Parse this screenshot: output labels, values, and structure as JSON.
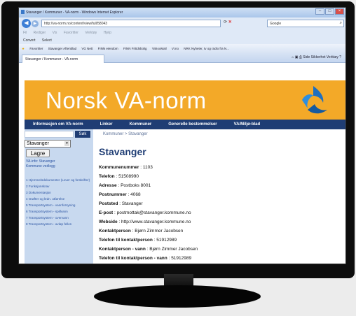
{
  "browser": {
    "window_title": "Stavanger / Kommuner - VA-norm - Windows Internet Explorer",
    "url": "http://va-norm.no/content/view/full/58043",
    "search_text": "Google",
    "menu_items": [
      "Fil",
      "Rediger",
      "Vis",
      "Favoritter",
      "Verktøy",
      "Hjelp"
    ],
    "convert_label": "Convert",
    "select_label": "Select",
    "favorites_label": "Favoritter",
    "favorites": [
      "Stavanger Aftenblad",
      "VG Nett",
      "FINN eiendom",
      "FINN Fritidsbolig",
      "YahooMail",
      "Vi.no",
      "NRK Nyheter, tv og radio fra N..."
    ],
    "tab_title": "Stavanger / Kommuner - VA-norm",
    "command_bar": [
      "Side",
      "Sikkerhet",
      "Verktøy"
    ]
  },
  "site": {
    "banner_title": "Norsk VA-norm",
    "nav": [
      "Informasjon om VA-norm",
      "Linker",
      "Kommuner",
      "Generelle bestemmelser",
      "VA/Miljø-blad"
    ],
    "search_button": "Søk",
    "municipality_select": "Stavanger",
    "save_button": "Lagre",
    "info_links": [
      "VA-info: Stavanger",
      "Kommune vedlegg"
    ],
    "menu": [
      "1 Hjemmelsdokumenter (Lover og forskrifter)",
      "2 Funksjonskrav",
      "3 Dokumentasjon",
      "4 Grøfter og ledn. utførelse",
      "5 Transportsystem - vannforsyning",
      "6 Transportsystem - spillvann",
      "7 Transportsystem - overvann",
      "8 Transportsystem - avløp felles"
    ],
    "breadcrumb": "Kommuner > Stavanger",
    "heading": "Stavanger",
    "fields": [
      {
        "label": "Kommunenummer",
        "value": "1103"
      },
      {
        "label": "Telefon",
        "value": "51508990"
      },
      {
        "label": "Adresse",
        "value": "Postboks 8001"
      },
      {
        "label": "Postnummer",
        "value": "4068"
      },
      {
        "label": "Poststed",
        "value": "Stavanger"
      },
      {
        "label": "E-post",
        "value": "postmottak@stavanger.kommune.no"
      },
      {
        "label": "Webside",
        "value": "http://www.stavanger.kommune.no"
      },
      {
        "label": "Kontaktperson",
        "value": "Bjørn Zimmer Jacobsen"
      },
      {
        "label": "Telefon til kontaktperson",
        "value": "51912989"
      },
      {
        "label": "Kontaktperson - vann",
        "value": "Bjørn Zimmer Jacobsen"
      },
      {
        "label": "Telefon til kontaktperson - vann",
        "value": "51912989"
      }
    ]
  },
  "colors": {
    "banner": "#f3a928",
    "navbar": "#1f3d74",
    "sidebar": "#c8d9ef",
    "heading": "#1f3d74"
  }
}
